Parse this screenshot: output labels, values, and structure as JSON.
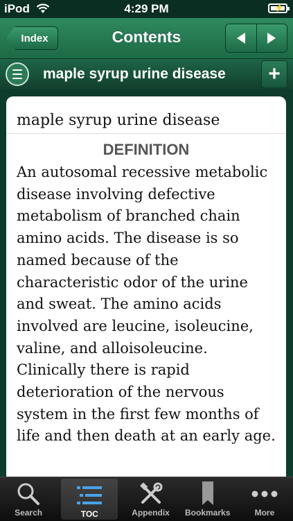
{
  "status": {
    "carrier": "iPod",
    "time": "4:29 PM"
  },
  "navbar": {
    "back_label": "Index",
    "title": "Contents"
  },
  "subheader": {
    "title": "maple syrup urine disease"
  },
  "content": {
    "term": "maple syrup urine disease",
    "section_heading": "DEFINITION",
    "definition": "An autosomal recessive metabolic disease involving defective metabolism of branched chain amino acids. The disease is so named because of the characteristic odor of the urine and sweat. The amino acids involved are leucine, isoleucine, valine, and alloisoleucine. Clinically there is rapid deterioration of the nervous system in the first few months of life and then death at an early age."
  },
  "tabbar": {
    "tabs": [
      {
        "label": "Search",
        "icon": "search-icon"
      },
      {
        "label": "TOC",
        "icon": "list-icon",
        "active": true
      },
      {
        "label": "Appendix",
        "icon": "tools-icon"
      },
      {
        "label": "Bookmarks",
        "icon": "bookmark-icon"
      },
      {
        "label": "More",
        "icon": "more-icon"
      }
    ]
  },
  "colors": {
    "nav_green": "#2f8a5f",
    "tab_active_blue": "#4aa3e8"
  }
}
